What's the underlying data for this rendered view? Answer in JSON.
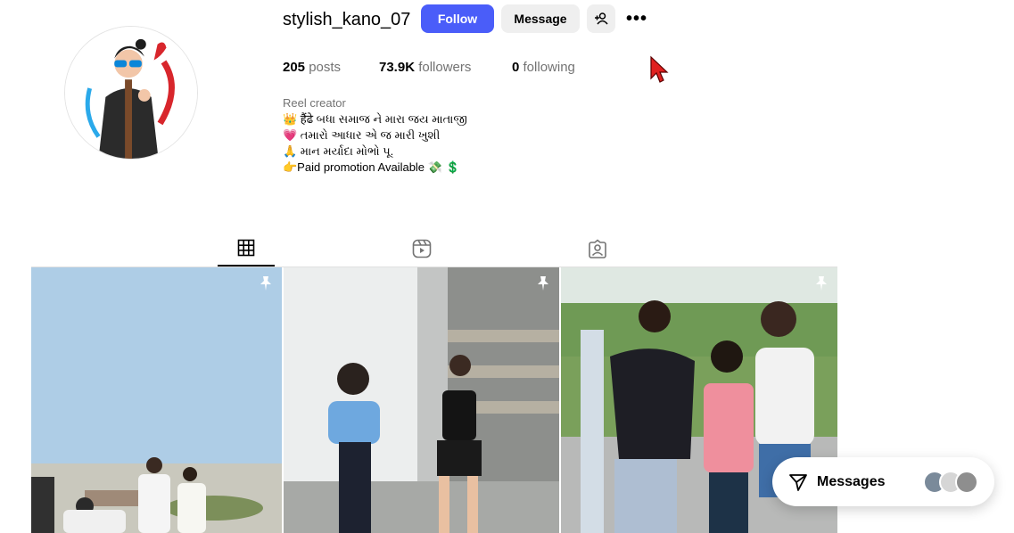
{
  "profile": {
    "username": "stylish_kano_07",
    "follow_label": "Follow",
    "message_label": "Message",
    "add_user_icon": "person-plus-icon",
    "more_icon": "more-horizontal-icon",
    "more_label": "•••"
  },
  "stats": {
    "posts_count": "205",
    "posts_label": "posts",
    "followers_count": "73.9K",
    "followers_label": "followers",
    "following_count": "0",
    "following_label": "following"
  },
  "bio": {
    "category": "Reel creator",
    "lines": [
      "👑 हैंढे બધા સમાજ ને મારા જય માતાજી",
      "💗 તમારો આધાર એ જ મારી ખુશી",
      "🙏 માન મર્યાદા મોભો પૂ.",
      "👉Paid promotion Available 💸 💲"
    ]
  },
  "tabs": [
    {
      "name": "posts",
      "icon": "grid-icon",
      "active": true
    },
    {
      "name": "reels",
      "icon": "reels-icon",
      "active": false
    },
    {
      "name": "tagged",
      "icon": "tagged-icon",
      "active": false
    }
  ],
  "posts": [
    {
      "pinned": true,
      "icon": "pin-icon"
    },
    {
      "pinned": true,
      "icon": "pin-icon"
    },
    {
      "pinned": true,
      "icon": "pin-icon"
    }
  ],
  "messages": {
    "label": "Messages",
    "icon": "send-icon"
  },
  "colors": {
    "follow_button": "#4a5df9",
    "secondary_button": "#efefef",
    "muted_text": "#737373",
    "cursor": "#e0201f"
  }
}
